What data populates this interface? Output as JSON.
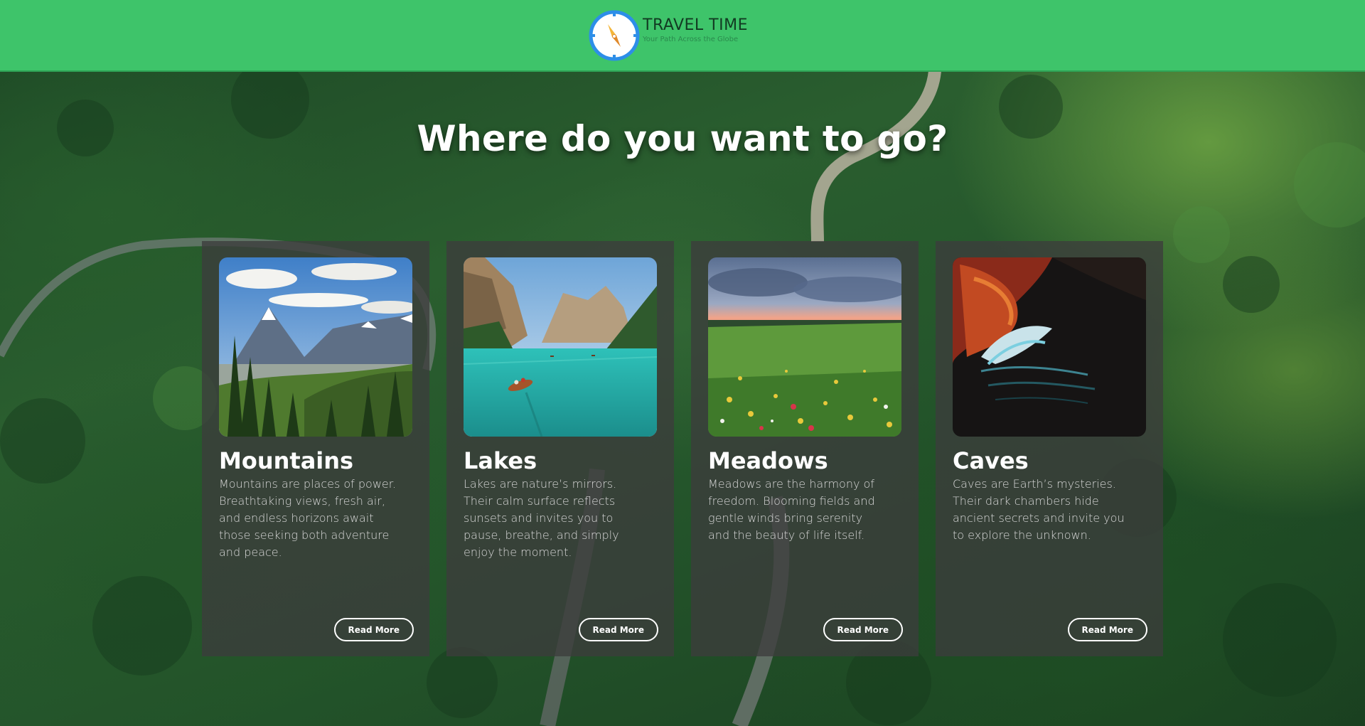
{
  "header": {
    "brand_title": "TRAVEL TIME",
    "brand_subtitle": "Your Path Across the Globe",
    "logo_icon": "compass-icon",
    "background_color": "#3ec46a"
  },
  "main": {
    "headline": "Where do you want to go?",
    "cards": [
      {
        "title": "Mountains",
        "description": "Mountains are places of power. Breathtaking views, fresh air, and endless horizons await those seeking both adventure and peace.",
        "button_label": "Read More",
        "image": "mountains-image"
      },
      {
        "title": "Lakes",
        "description": "Lakes are nature’s mirrors. Their calm surface reflects sunsets and invites you to pause, breathe, and simply enjoy the moment.",
        "button_label": "Read More",
        "image": "lake-image"
      },
      {
        "title": "Meadows",
        "description": "Meadows are the harmony of freedom. Blooming fields and gentle winds bring serenity and the beauty of life itself.",
        "button_label": "Read More",
        "image": "meadow-image"
      },
      {
        "title": "Caves",
        "description": "Caves are Earth’s mysteries. Their dark chambers hide ancient secrets and invite you to explore the unknown.",
        "button_label": "Read More",
        "image": "cave-image"
      }
    ]
  }
}
